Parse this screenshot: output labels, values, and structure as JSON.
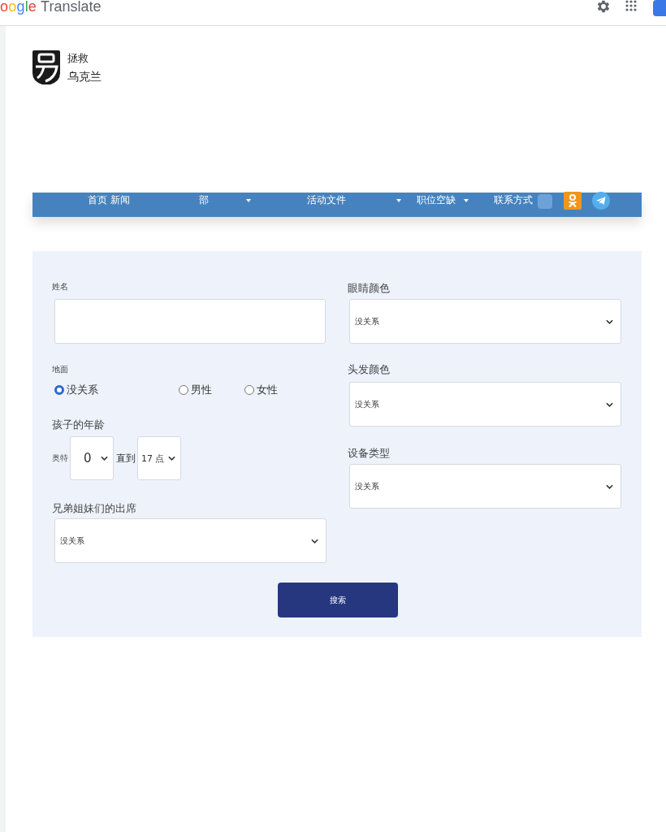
{
  "browser_bar": {
    "brand": "oogle",
    "product": "Translate"
  },
  "site_logo": {
    "line_1": "拯救",
    "line_2": "乌克兰"
  },
  "nav": {
    "items": [
      {
        "label": "首页 新闻",
        "dropdown": false
      },
      {
        "label": "部",
        "dropdown": true
      },
      {
        "label": "活动文件",
        "dropdown": true
      },
      {
        "label": "职位空缺",
        "dropdown": true
      },
      {
        "label": "联系方式",
        "dropdown": false
      }
    ]
  },
  "form": {
    "left": [
      {
        "kind": "text",
        "label": "姓名"
      },
      {
        "kind": "radio",
        "label": "地面",
        "options": [
          {
            "label": "没关系",
            "selected": true
          },
          {
            "label": "男性",
            "selected": false
          },
          {
            "label": "女性",
            "selected": false
          }
        ]
      },
      {
        "kind": "range",
        "label": "孩子的年龄",
        "from_label": "奥特",
        "from_value": "0",
        "to_label": "直到",
        "to_value": "17 点"
      },
      {
        "kind": "select",
        "label": "兄弟姐妹们的出席",
        "value": "没关系"
      }
    ],
    "right": [
      {
        "kind": "select",
        "label": "眼睛颜色",
        "value": "没关系"
      },
      {
        "kind": "select",
        "label": "头发颜色",
        "value": "没关系"
      },
      {
        "kind": "select",
        "label": "设备类型",
        "value": "没关系"
      }
    ],
    "submit": "搜索"
  }
}
